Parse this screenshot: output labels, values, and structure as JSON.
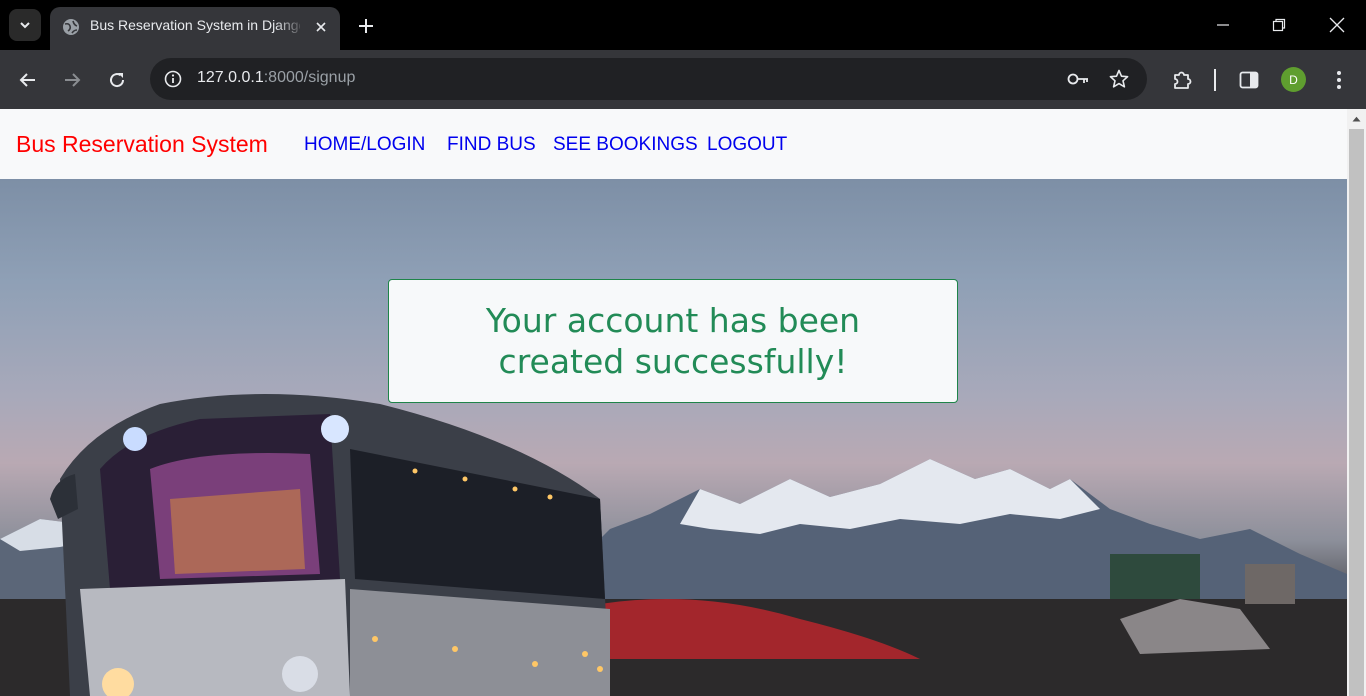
{
  "browser": {
    "tab": {
      "title": "Bus Reservation System in Django"
    },
    "address_bar": {
      "host": "127.0.0.1",
      "rest": ":8000/signup"
    },
    "profile_initial": "D"
  },
  "site": {
    "brand": "Bus Reservation System",
    "nav_links": [
      "HOME/LOGIN",
      "FIND BUS",
      "SEE BOOKINGS",
      "LOGOUT"
    ]
  },
  "alert": {
    "message": "Your account has been created successfully!"
  },
  "colors": {
    "brand": "#ff0000",
    "link": "#0000ee",
    "alert_text": "#228b57",
    "alert_border": "#1e8449"
  }
}
